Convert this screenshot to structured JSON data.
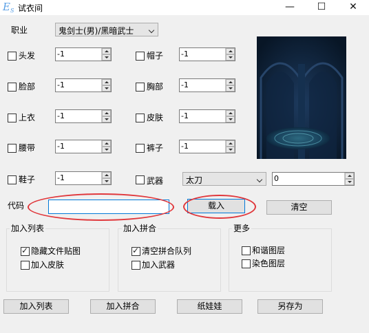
{
  "window": {
    "icon_text": "E",
    "icon_sub": "S",
    "title": "试衣间",
    "minimize_glyph": "—",
    "maximize_glyph": "☐",
    "close_glyph": "✕"
  },
  "job": {
    "label": "职业",
    "selected": "鬼剑士(男)/黑暗武士"
  },
  "slots": {
    "hair": {
      "label": "头发",
      "value": "-1",
      "checked": false
    },
    "cap": {
      "label": "帽子",
      "value": "-1",
      "checked": false
    },
    "face": {
      "label": "脸部",
      "value": "-1",
      "checked": false
    },
    "neck": {
      "label": "胸部",
      "value": "-1",
      "checked": false
    },
    "coat": {
      "label": "上衣",
      "value": "-1",
      "checked": false
    },
    "skin": {
      "label": "皮肤",
      "value": "-1",
      "checked": false
    },
    "belt": {
      "label": "腰带",
      "value": "-1",
      "checked": false
    },
    "pants": {
      "label": "裤子",
      "value": "-1",
      "checked": false
    },
    "shoes": {
      "label": "鞋子",
      "value": "-1",
      "checked": false
    },
    "weapon": {
      "label": "武器",
      "type_selected": "太刀",
      "value": "0",
      "checked": false
    }
  },
  "code": {
    "label": "代码",
    "value": "",
    "load_button": "载入",
    "clear_button": "清空"
  },
  "groups": {
    "add_list": {
      "title": "加入列表",
      "options": [
        {
          "label": "隐藏文件贴图",
          "checked": true
        },
        {
          "label": "加入皮肤",
          "checked": false
        }
      ]
    },
    "add_combine": {
      "title": "加入拼合",
      "options": [
        {
          "label": "清空拼合队列",
          "checked": true
        },
        {
          "label": "加入武器",
          "checked": false
        }
      ]
    },
    "more": {
      "title": "更多",
      "options": [
        {
          "label": "和谐图层",
          "checked": false
        },
        {
          "label": "染色图层",
          "checked": false
        }
      ]
    }
  },
  "bottom_buttons": {
    "add_list": "加入列表",
    "add_combine": "加入拼合",
    "paper_doll": "纸娃娃",
    "save_as": "另存为"
  },
  "colors": {
    "annotation_red": "#e0373b",
    "focus_blue": "#0078d7",
    "preview_bg": "#0e1f33"
  }
}
